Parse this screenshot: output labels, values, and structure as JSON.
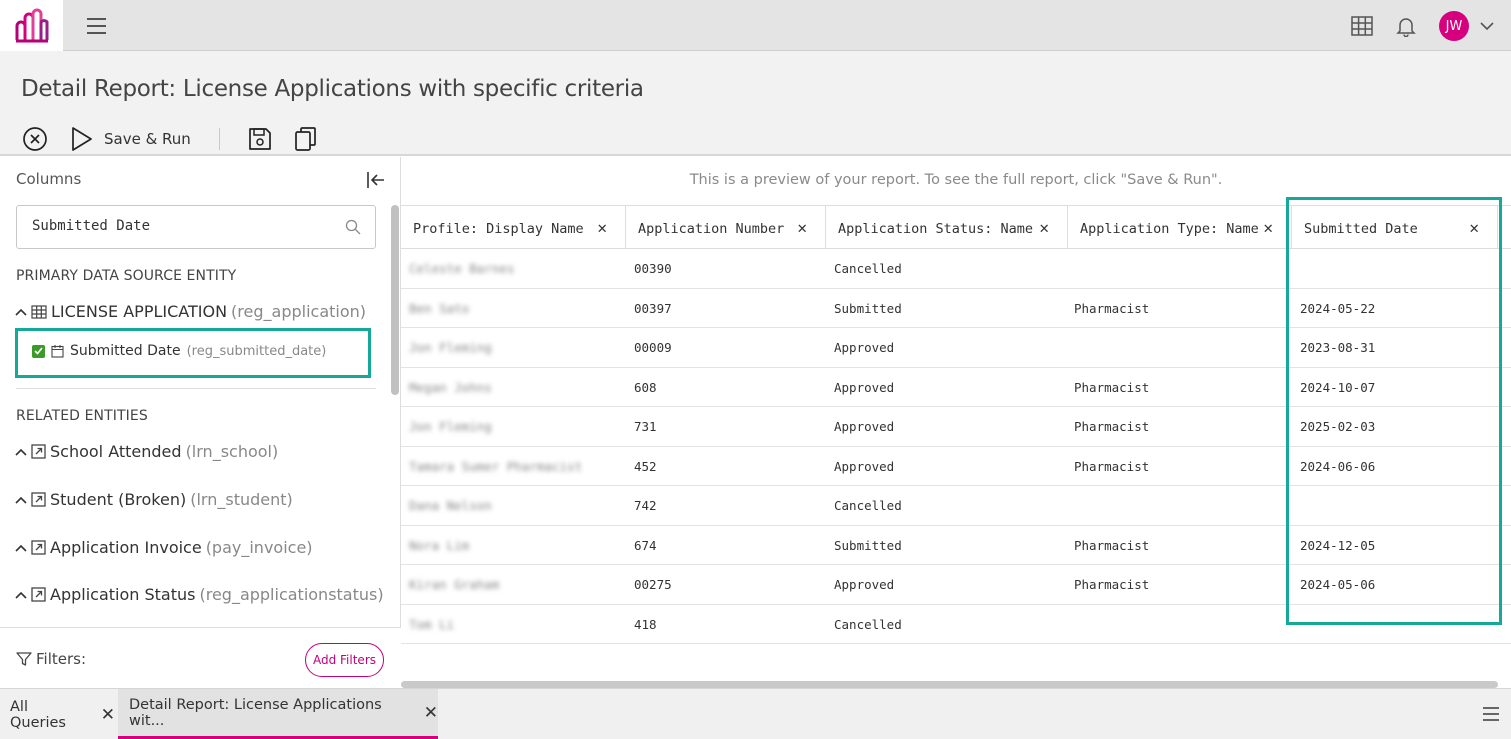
{
  "header": {
    "title": "Detail Report: License Applications with specific criteria",
    "save_run_label": "Save & Run",
    "avatar_initials": "JW"
  },
  "left_panel": {
    "columns_label": "Columns",
    "search_value": "Submitted Date",
    "primary_section_label": "PRIMARY DATA SOURCE ENTITY",
    "primary_entity": {
      "name": "LICENSE APPLICATION",
      "code": "(reg_application)"
    },
    "selected_field": {
      "name": "Submitted Date",
      "code": "(reg_submitted_date)",
      "checked": true
    },
    "related_section_label": "RELATED ENTITIES",
    "related_entities": [
      {
        "name": "School Attended",
        "code": "(lrn_school)"
      },
      {
        "name": "Student (Broken)",
        "code": "(lrn_student)"
      },
      {
        "name": "Application Invoice",
        "code": "(pay_invoice)"
      },
      {
        "name": "Application Status",
        "code": "(reg_applicationstatus)"
      }
    ],
    "filters_label": "Filters:",
    "add_filters_label": "Add Filters"
  },
  "preview": {
    "note": "This is a preview of your report. To see the full report, click \"Save & Run\".",
    "columns": [
      "Profile: Display Name",
      "Application Number",
      "Application Status: Name",
      "Application Type: Name",
      "Submitted Date"
    ],
    "rows": [
      {
        "name": "Celeste Barnes",
        "number": "00390",
        "status": "Cancelled",
        "type": "",
        "date": ""
      },
      {
        "name": "Ben Sato",
        "number": "00397",
        "status": "Submitted",
        "type": "Pharmacist",
        "date": "2024-05-22"
      },
      {
        "name": "Jon Fleming",
        "number": "00009",
        "status": "Approved",
        "type": "",
        "date": "2023-08-31"
      },
      {
        "name": "Megan Johns",
        "number": "608",
        "status": "Approved",
        "type": "Pharmacist",
        "date": "2024-10-07"
      },
      {
        "name": "Jon Fleming",
        "number": "731",
        "status": "Approved",
        "type": "Pharmacist",
        "date": "2025-02-03"
      },
      {
        "name": "Tamara Sumer Pharmacist",
        "number": "452",
        "status": "Approved",
        "type": "Pharmacist",
        "date": "2024-06-06"
      },
      {
        "name": "Dana Nelson",
        "number": "742",
        "status": "Cancelled",
        "type": "",
        "date": ""
      },
      {
        "name": "Nora Lim",
        "number": "674",
        "status": "Submitted",
        "type": "Pharmacist",
        "date": "2024-12-05"
      },
      {
        "name": "Kiran Graham",
        "number": "00275",
        "status": "Approved",
        "type": "Pharmacist",
        "date": "2024-05-06"
      },
      {
        "name": "Tom Li",
        "number": "418",
        "status": "Cancelled",
        "type": "",
        "date": ""
      }
    ]
  },
  "bottom_tabs": [
    {
      "label": "All Queries"
    },
    {
      "label": "Detail Report: License Applications wit..."
    }
  ],
  "colors": {
    "brand": "#d6007f",
    "highlight": "#16a99a",
    "checkbox": "#3c9a2b"
  }
}
